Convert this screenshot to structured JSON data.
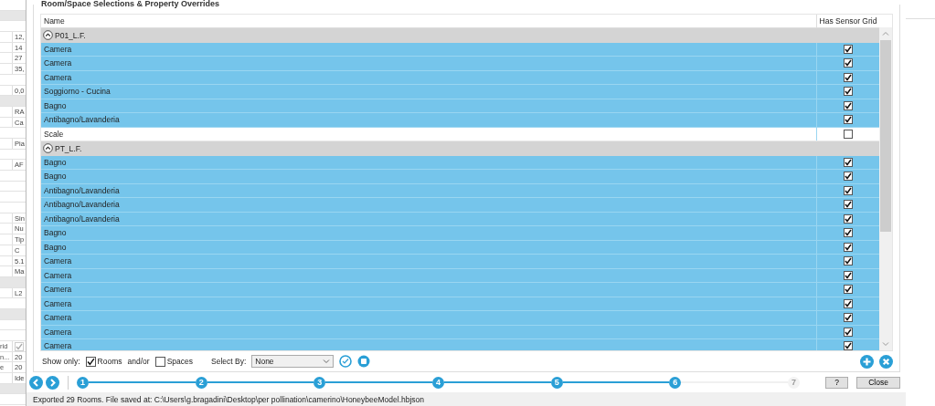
{
  "background_sheet": {
    "rows": [
      {
        "kind": "blank"
      },
      {
        "kind": "shaded"
      },
      {
        "kind": "blank"
      },
      {
        "kind": "cell",
        "column_2": "12,"
      },
      {
        "kind": "cell",
        "column_2": "14"
      },
      {
        "kind": "cell",
        "column_2": "27"
      },
      {
        "kind": "cell",
        "column_2": "35,"
      },
      {
        "kind": "blank"
      },
      {
        "kind": "cell",
        "column_2": "0,0"
      },
      {
        "kind": "shaded"
      },
      {
        "kind": "cell",
        "column_2": "RA"
      },
      {
        "kind": "cell",
        "column_2": "Ca"
      },
      {
        "kind": "blank"
      },
      {
        "kind": "cell",
        "column_2": "Pia"
      },
      {
        "kind": "blank"
      },
      {
        "kind": "cell",
        "column_2": "AF"
      },
      {
        "kind": "blank"
      },
      {
        "kind": "blank"
      },
      {
        "kind": "blank"
      },
      {
        "kind": "blank"
      },
      {
        "kind": "cell",
        "column_2": "Sin"
      },
      {
        "kind": "cell",
        "column_2": "Nu"
      },
      {
        "kind": "cell",
        "column_2": "Tip"
      },
      {
        "kind": "cell",
        "column_2": "C"
      },
      {
        "kind": "cell",
        "column_2": "5.1"
      },
      {
        "kind": "cell",
        "column_2": "Ma"
      },
      {
        "kind": "shaded"
      },
      {
        "kind": "cell",
        "column_2": "L2"
      },
      {
        "kind": "blank"
      },
      {
        "kind": "shaded"
      },
      {
        "kind": "blank"
      },
      {
        "kind": "blank"
      },
      {
        "kind": "cell",
        "column_1": "rid",
        "checked": true
      },
      {
        "kind": "cell",
        "column_1": "n...",
        "column_2": "20"
      },
      {
        "kind": "cell",
        "column_1": "e",
        "column_2": "20"
      },
      {
        "kind": "cell",
        "column_2": "Ide"
      },
      {
        "kind": "shaded"
      },
      {
        "kind": "blank"
      }
    ]
  },
  "dialog": {
    "group_title": "Room/Space Selections & Property Overrides",
    "table": {
      "columns": [
        "Name",
        "Has Sensor Grid"
      ],
      "groups": [
        {
          "name": "P01_L.F.",
          "expanded": true,
          "rows": [
            {
              "name": "Camera",
              "selected": true,
              "has_sensor_grid": true
            },
            {
              "name": "Camera",
              "selected": true,
              "has_sensor_grid": true
            },
            {
              "name": "Camera",
              "selected": true,
              "has_sensor_grid": true
            },
            {
              "name": "Soggiorno - Cucina",
              "selected": true,
              "has_sensor_grid": true
            },
            {
              "name": "Bagno",
              "selected": true,
              "has_sensor_grid": true
            },
            {
              "name": "Antibagno/Lavanderia",
              "selected": true,
              "has_sensor_grid": true
            },
            {
              "name": "Scale",
              "selected": false,
              "has_sensor_grid": false
            }
          ]
        },
        {
          "name": "PT_L.F.",
          "expanded": true,
          "rows": [
            {
              "name": "Bagno",
              "selected": true,
              "has_sensor_grid": true
            },
            {
              "name": "Bagno",
              "selected": true,
              "has_sensor_grid": true
            },
            {
              "name": "Antibagno/Lavanderia",
              "selected": true,
              "has_sensor_grid": true
            },
            {
              "name": "Antibagno/Lavanderia",
              "selected": true,
              "has_sensor_grid": true
            },
            {
              "name": "Antibagno/Lavanderia",
              "selected": true,
              "has_sensor_grid": true
            },
            {
              "name": "Bagno",
              "selected": true,
              "has_sensor_grid": true
            },
            {
              "name": "Bagno",
              "selected": true,
              "has_sensor_grid": true
            },
            {
              "name": "Camera",
              "selected": true,
              "has_sensor_grid": true
            },
            {
              "name": "Camera",
              "selected": true,
              "has_sensor_grid": true
            },
            {
              "name": "Camera",
              "selected": true,
              "has_sensor_grid": true
            },
            {
              "name": "Camera",
              "selected": true,
              "has_sensor_grid": true
            },
            {
              "name": "Camera",
              "selected": true,
              "has_sensor_grid": true
            },
            {
              "name": "Camera",
              "selected": true,
              "has_sensor_grid": true
            },
            {
              "name": "Camera",
              "selected": true,
              "has_sensor_grid": true
            }
          ]
        }
      ]
    },
    "filters": {
      "label": "Show only:",
      "options": [
        {
          "label": "Rooms",
          "checked": true
        },
        {
          "label": "Spaces",
          "checked": false
        }
      ],
      "joiner": "and/or",
      "select_by_label": "Select By:",
      "select_by_value": "None"
    },
    "steps": [
      {
        "label": "1",
        "enabled": true
      },
      {
        "label": "2",
        "enabled": true
      },
      {
        "label": "3",
        "enabled": true
      },
      {
        "label": "4",
        "enabled": true
      },
      {
        "label": "5",
        "enabled": true
      },
      {
        "label": "6",
        "enabled": true
      },
      {
        "label": "7",
        "enabled": false
      }
    ],
    "buttons": [
      "?",
      "Close"
    ],
    "status_bar": "Exported 29 Rooms. File saved at: C:\\Users\\g.bragadini\\Desktop\\per pollination\\camerino\\HoneybeeModel.hbjson"
  }
}
